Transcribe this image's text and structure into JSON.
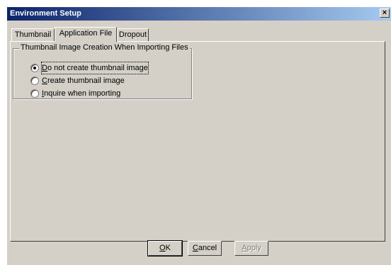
{
  "window": {
    "title": "Environment Setup",
    "close_glyph": "×"
  },
  "tabs": [
    {
      "label": "Thumbnail",
      "active": false
    },
    {
      "label": "Application File",
      "active": true
    },
    {
      "label": "Dropout",
      "active": false
    }
  ],
  "group": {
    "label": "Thumbnail Image Creation When Importing Files",
    "options": [
      {
        "prefix": "",
        "accel": "D",
        "rest": "o not create thumbnail image",
        "selected": true
      },
      {
        "prefix": "",
        "accel": "C",
        "rest": "reate thumbnail image",
        "selected": false
      },
      {
        "prefix": "",
        "accel": "I",
        "rest": "nquire when importing",
        "selected": false
      }
    ]
  },
  "buttons": {
    "ok": {
      "accel": "O",
      "rest": "K"
    },
    "cancel": {
      "accel": "C",
      "rest": "ancel"
    },
    "apply": {
      "accel": "A",
      "rest": "pply"
    }
  }
}
